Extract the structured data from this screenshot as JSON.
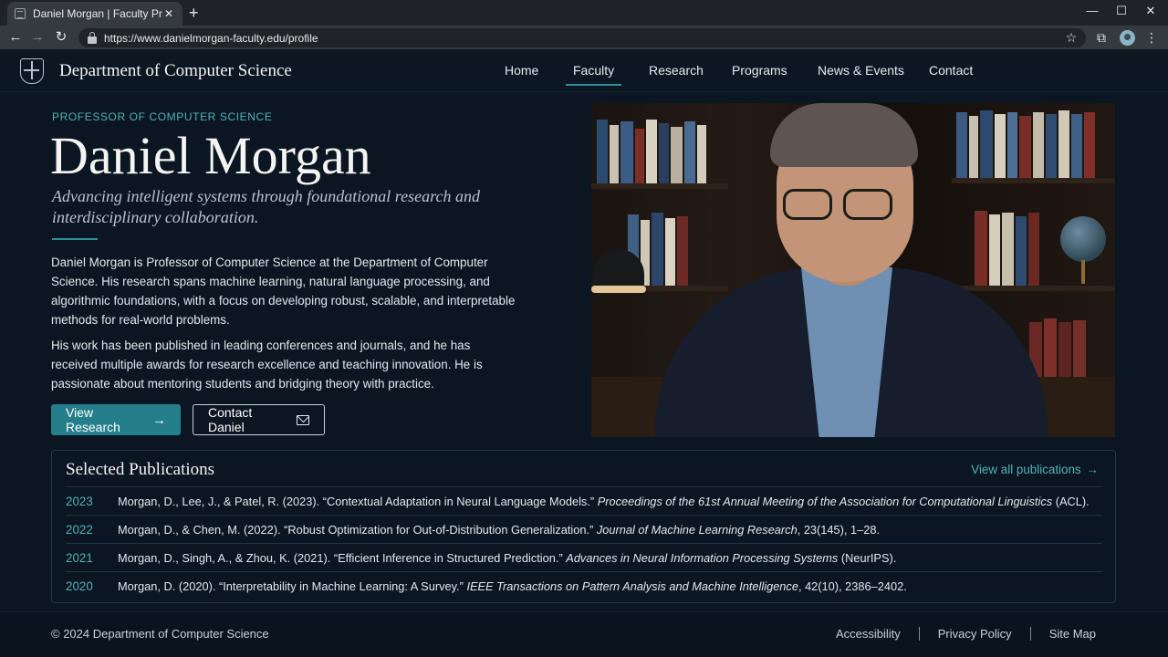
{
  "browser": {
    "tab_title": "Daniel Morgan | Faculty Profile",
    "url": "https://www.danielmorgan-faculty.edu/profile"
  },
  "site": {
    "department": "Department of Computer Science",
    "nav": [
      {
        "label": "Home",
        "active": false
      },
      {
        "label": "Faculty",
        "active": true
      },
      {
        "label": "Research",
        "active": false
      },
      {
        "label": "Programs",
        "active": false
      },
      {
        "label": "News & Events",
        "active": false
      },
      {
        "label": "Contact",
        "active": false
      }
    ]
  },
  "profile": {
    "eyebrow": "PROFESSOR OF COMPUTER SCIENCE",
    "name": "Daniel Morgan",
    "tagline": "Advancing intelligent systems through foundational research and interdisciplinary collaboration.",
    "bio": [
      "Daniel Morgan is Professor of Computer Science at the Department of Computer Science. His research spans machine learning, natural language processing, and algorithmic foundations, with a focus on developing robust, scalable, and interpretable methods for real-world problems.",
      "His work has been published in leading conferences and journals, and he has received multiple awards for research excellence and teaching innovation. He is passionate about mentoring students and bridging theory with practice."
    ],
    "primary_button": "View Research",
    "secondary_button": "Contact Daniel"
  },
  "publications": {
    "title": "Selected Publications",
    "view_all": "View all publications",
    "items": [
      {
        "year": "2023",
        "citation": "Morgan, D., Lee, J., & Patel, R. (2023). “Contextual Adaptation in Neural Language Models.”",
        "venue": "Proceedings of the 61st Annual Meeting of the Association for Computational Linguistics",
        "suffix": "(ACL)."
      },
      {
        "year": "2022",
        "citation": "Morgan, D., & Chen, M. (2022). “Robust Optimization for Out-of-Distribution Generalization.”",
        "venue": "Journal of Machine Learning Research",
        "suffix": ", 23(145), 1–28."
      },
      {
        "year": "2021",
        "citation": "Morgan, D., Singh, A., & Zhou, K. (2021). “Efficient Inference in Structured Prediction.”",
        "venue": "Advances in Neural Information Processing Systems",
        "suffix": "(NeurIPS)."
      },
      {
        "year": "2020",
        "citation": "Morgan, D. (2020). “Interpretability in Machine Learning: A Survey.”",
        "venue": "IEEE Transactions on Pattern Analysis and Machine Intelligence",
        "suffix": ", 42(10), 2386–2402."
      }
    ]
  },
  "footer": {
    "copyright": "© 2024 Department of Computer Science",
    "links": [
      "Accessibility",
      "Privacy Policy",
      "Site Map"
    ]
  },
  "colors": {
    "accent": "#2b8f97",
    "accent_text": "#4fb3bb",
    "background": "#0b1622"
  }
}
